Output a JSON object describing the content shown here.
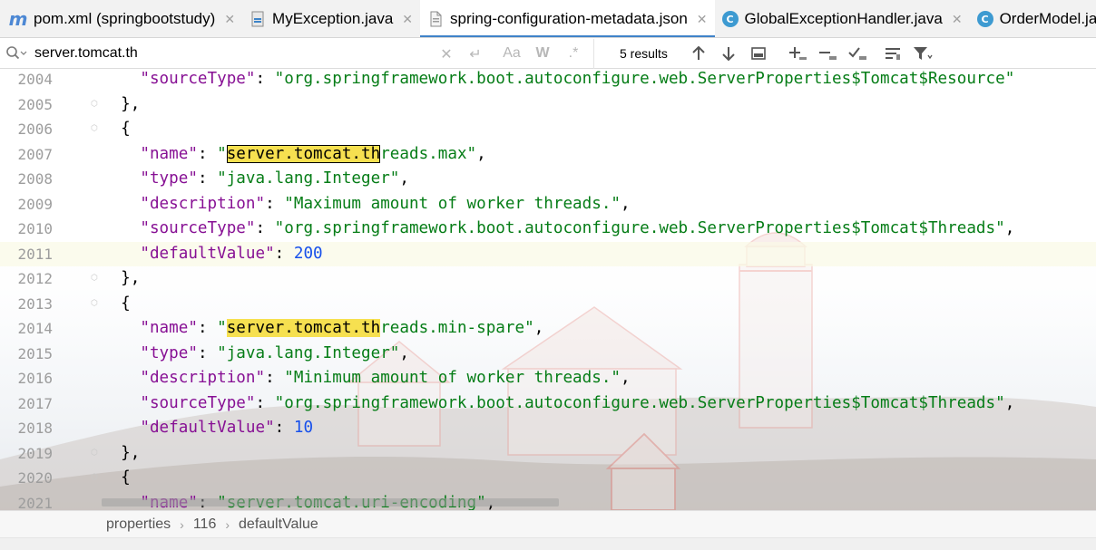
{
  "tabs": [
    {
      "label": "pom.xml (springbootstudy)",
      "icon": "maven-m-icon",
      "active": false
    },
    {
      "label": "MyException.java",
      "icon": "java-file-icon",
      "active": false
    },
    {
      "label": "spring-configuration-metadata.json",
      "icon": "json-file-icon",
      "active": true
    },
    {
      "label": "GlobalExceptionHandler.java",
      "icon": "class-c-icon",
      "active": false
    },
    {
      "label": "OrderModel.java",
      "icon": "class-c-icon",
      "active": false
    }
  ],
  "search": {
    "value": "server.tomcat.th",
    "results": "5 results"
  },
  "breadcrumb": [
    "properties",
    "116",
    "defaultValue"
  ],
  "colors": {
    "key": "#871094",
    "string": "#067d17",
    "number": "#1750eb",
    "match_highlight": "#f6e050",
    "active_tab_underline": "#4083c9"
  },
  "lines": [
    {
      "no": "2004",
      "fold": false,
      "tokens": [
        [
          "p",
          "    "
        ],
        [
          "k",
          "\"sourceType\""
        ],
        [
          "p",
          ": "
        ],
        [
          "s",
          "\"org.springframework.boot.autoconfigure.web.ServerProperties$Tomcat$Resource\""
        ]
      ]
    },
    {
      "no": "2005",
      "fold": true,
      "tokens": [
        [
          "p",
          "  },"
        ]
      ]
    },
    {
      "no": "2006",
      "fold": true,
      "tokens": [
        [
          "p",
          "  {"
        ]
      ]
    },
    {
      "no": "2007",
      "fold": false,
      "tokens": [
        [
          "p",
          "    "
        ],
        [
          "k",
          "\"name\""
        ],
        [
          "p",
          ": "
        ],
        [
          "s",
          "\""
        ],
        [
          "hlc",
          "server.tomcat.th"
        ],
        [
          "s",
          "reads.max\""
        ],
        [
          "p",
          ","
        ]
      ]
    },
    {
      "no": "2008",
      "fold": false,
      "tokens": [
        [
          "p",
          "    "
        ],
        [
          "k",
          "\"type\""
        ],
        [
          "p",
          ": "
        ],
        [
          "s",
          "\"java.lang.Integer\""
        ],
        [
          "p",
          ","
        ]
      ]
    },
    {
      "no": "2009",
      "fold": false,
      "tokens": [
        [
          "p",
          "    "
        ],
        [
          "k",
          "\"description\""
        ],
        [
          "p",
          ": "
        ],
        [
          "s",
          "\"Maximum amount of worker threads.\""
        ],
        [
          "p",
          ","
        ]
      ]
    },
    {
      "no": "2010",
      "fold": false,
      "tokens": [
        [
          "p",
          "    "
        ],
        [
          "k",
          "\"sourceType\""
        ],
        [
          "p",
          ": "
        ],
        [
          "s",
          "\"org.springframework.boot.autoconfigure.web.ServerProperties$Tomcat$Threads\""
        ],
        [
          "p",
          ","
        ]
      ]
    },
    {
      "no": "2011",
      "fold": false,
      "current": true,
      "tokens": [
        [
          "p",
          "    "
        ],
        [
          "k",
          "\"defaultValue\""
        ],
        [
          "p",
          ": "
        ],
        [
          "n",
          "200"
        ]
      ]
    },
    {
      "no": "2012",
      "fold": true,
      "tokens": [
        [
          "p",
          "  },"
        ]
      ]
    },
    {
      "no": "2013",
      "fold": true,
      "tokens": [
        [
          "p",
          "  {"
        ]
      ]
    },
    {
      "no": "2014",
      "fold": false,
      "tokens": [
        [
          "p",
          "    "
        ],
        [
          "k",
          "\"name\""
        ],
        [
          "p",
          ": "
        ],
        [
          "s",
          "\""
        ],
        [
          "hl",
          "server.tomcat.th"
        ],
        [
          "s",
          "reads.min-spare\""
        ],
        [
          "p",
          ","
        ]
      ]
    },
    {
      "no": "2015",
      "fold": false,
      "tokens": [
        [
          "p",
          "    "
        ],
        [
          "k",
          "\"type\""
        ],
        [
          "p",
          ": "
        ],
        [
          "s",
          "\"java.lang.Integer\""
        ],
        [
          "p",
          ","
        ]
      ]
    },
    {
      "no": "2016",
      "fold": false,
      "tokens": [
        [
          "p",
          "    "
        ],
        [
          "k",
          "\"description\""
        ],
        [
          "p",
          ": "
        ],
        [
          "s",
          "\"Minimum amount of worker threads.\""
        ],
        [
          "p",
          ","
        ]
      ]
    },
    {
      "no": "2017",
      "fold": false,
      "tokens": [
        [
          "p",
          "    "
        ],
        [
          "k",
          "\"sourceType\""
        ],
        [
          "p",
          ": "
        ],
        [
          "s",
          "\"org.springframework.boot.autoconfigure.web.ServerProperties$Tomcat$Threads\""
        ],
        [
          "p",
          ","
        ]
      ]
    },
    {
      "no": "2018",
      "fold": false,
      "tokens": [
        [
          "p",
          "    "
        ],
        [
          "k",
          "\"defaultValue\""
        ],
        [
          "p",
          ": "
        ],
        [
          "n",
          "10"
        ]
      ]
    },
    {
      "no": "2019",
      "fold": true,
      "tokens": [
        [
          "p",
          "  },"
        ]
      ]
    },
    {
      "no": "2020",
      "fold": true,
      "tokens": [
        [
          "p",
          "  {"
        ]
      ]
    },
    {
      "no": "2021",
      "fold": false,
      "tokens": [
        [
          "p",
          "    "
        ],
        [
          "k",
          "\"name\""
        ],
        [
          "p",
          ": "
        ],
        [
          "s",
          "\"server.tomcat.uri-encoding\""
        ],
        [
          "p",
          ","
        ]
      ]
    }
  ]
}
